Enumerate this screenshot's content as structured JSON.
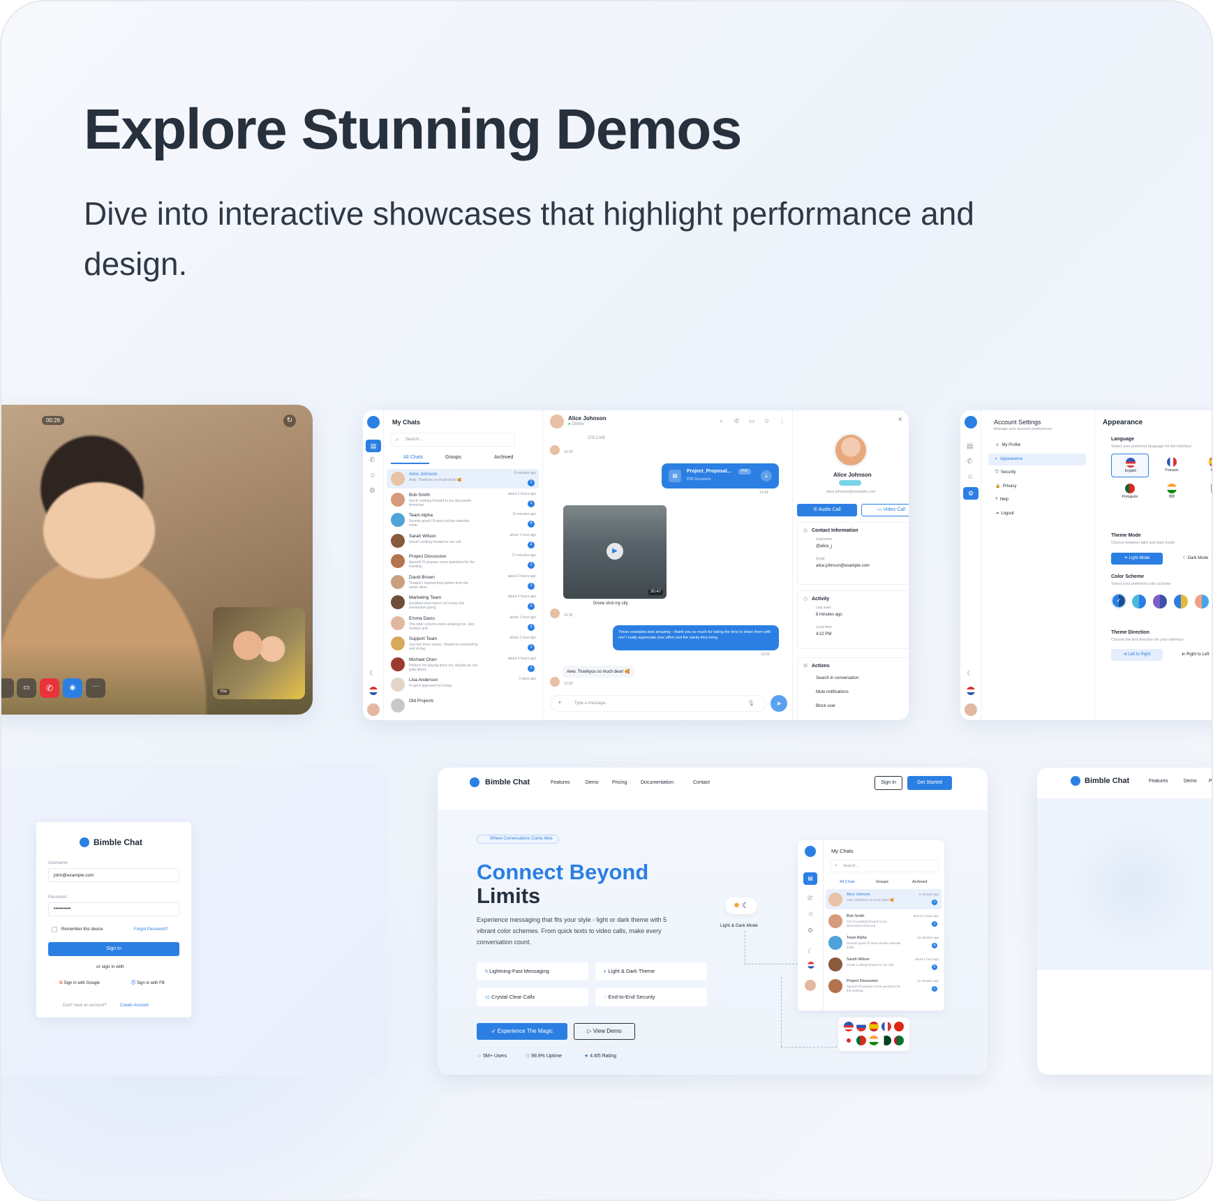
{
  "hero": {
    "title": "Explore Stunning Demos",
    "subtitle": "Dive into interactive showcases that highlight performance and design."
  },
  "video": {
    "timer": "00:26",
    "pip_label": "You"
  },
  "chat": {
    "title": "My Chats",
    "search_placeholder": "Search...",
    "tabs": [
      "All Chats",
      "Groups",
      "Archived"
    ],
    "items": [
      {
        "name": "Alice Johnson",
        "msg": "Aww, Thankyou so much dear! 🥰",
        "time": "8 minutes ago",
        "badge": "1"
      },
      {
        "name": "Bob Smith",
        "msg": "Got it! Looking forward to our discussion tomorrow.",
        "time": "about 2 hours ago",
        "badge": "1"
      },
      {
        "name": "Team Alpha",
        "msg": "Sounds good! I'll send out the calendar invite.",
        "time": "16 minutes ago",
        "badge": "4"
      },
      {
        "name": "Sarah Wilson",
        "msg": "Great! Looking forward to our call.",
        "time": "about 1 hour ago",
        "badge": "2"
      },
      {
        "name": "Project Discussion",
        "msg": "Agreed! I'll prepare some questions for the meeting.",
        "time": "21 minutes ago",
        "badge": "1"
      },
      {
        "name": "David Brown",
        "msg": "Thanks! I learned that pattern from the senior devs.",
        "time": "about 3 hours ago",
        "badge": "1"
      },
      {
        "name": "Marketing Team",
        "msg": "Excellent work team! Let's keep this momentum going.",
        "time": "about 4 hours ago",
        "badge": "1"
      },
      {
        "name": "Emma Davis",
        "msg": "The color scheme looks amazing too. Very modern and",
        "time": "about 1 hour ago",
        "badge": "1"
      },
      {
        "name": "Support Team",
        "msg": "Just two more issues. Should be resolved by end of day.",
        "time": "about 1 hour ago",
        "badge": "1"
      },
      {
        "name": "Michael Chen",
        "msg": "Perfect! I'm staying there too. Maybe we can grab dinner",
        "time": "about 4 hours ago",
        "badge": "1"
      },
      {
        "name": "Lisa Anderson",
        "msg": "I'll get it approved by Friday.",
        "time": "3 days ago",
        "badge": ""
      },
      {
        "name": "Old Projects",
        "msg": "",
        "time": "",
        "badge": ""
      }
    ],
    "conv": {
      "name": "Alice Johnson",
      "status": "Online",
      "file_size": "378.3 KB",
      "t1": "14:29",
      "file_name": "Project_Proposal...",
      "file_badge": "PDF",
      "file_sub": "PDF Document",
      "t2": "14:34",
      "video_len": "30:47",
      "video_caption": "Drone shot my city",
      "t3": "14:36",
      "bubble": "These examples look amazing – thank you so much for taking the time to share them with me! I really appreciate your effort and the clarity they bring.",
      "t4": "15:59",
      "reply": "Aww, Thankyou so much dear! 🥰",
      "t5": "16:00",
      "input_placeholder": "Type a message..."
    },
    "profile": {
      "name": "Alice Johnson",
      "email": "alice.johnson@example.com",
      "audio": "Audio Call",
      "video": "Video Call",
      "contact_title": "Contact Information",
      "username_label": "Username",
      "username": "@alice_j",
      "email_label": "Email",
      "activity_title": "Activity",
      "last_seen_label": "Last seen",
      "last_seen": "8 minutes ago",
      "local_label": "Local time",
      "local": "4:10 PM",
      "actions_title": "Actions",
      "a1": "Search in conversation",
      "a2": "Mute notifications",
      "a3": "Block user"
    }
  },
  "settings": {
    "title": "Account Settings",
    "sub": "Manage your account preferences",
    "menu": [
      "My Profile",
      "Appearance",
      "Security",
      "Privacy",
      "Help",
      "Logout"
    ],
    "appearance": "Appearance",
    "lang_title": "Language",
    "lang_sub": "Select your preferred language for the interface",
    "langs": [
      "English",
      "Français",
      "Esp",
      "Português",
      "हिंदी",
      "A"
    ],
    "theme_title": "Theme Mode",
    "theme_sub": "Choose between light and dark mode",
    "light": "Light Mode",
    "dark": "Dark Mode",
    "color_title": "Color Scheme",
    "color_sub": "Select your preferred color scheme",
    "dir_title": "Theme Direction",
    "dir_sub": "Choose the text direction for your interface",
    "ltr": "Left to Right",
    "rtl": "Right to Left"
  },
  "login": {
    "brand": "Bimble Chat",
    "username_label": "Username",
    "username": "john@example.com",
    "password_label": "Password",
    "password": "••••••••••",
    "remember": "Remember this device",
    "forgot": "Forgot Password?",
    "signin": "Sign In",
    "or": "or sign in with",
    "google": "Sign in with Google",
    "fb": "Sign in with FB",
    "no_account": "Don't have an account?",
    "create": "Create Account"
  },
  "landing": {
    "brand": "Bimble Chat",
    "nav": [
      "Features",
      "Demo",
      "Pricing",
      "Documentation",
      "Contact"
    ],
    "signin": "Sign In",
    "started": "Get Started",
    "tag": "Where Conversations Come Alive",
    "h1a": "Connect Beyond",
    "h1b": "Limits",
    "desc": "Experience messaging that fits your style - light or dark theme with 5 vibrant color schemes. From quick texts to video calls, make every conversation count.",
    "feats": [
      "Lightning-Fast Messaging",
      "Light & Dark Theme",
      "Crystal Clear Calls",
      "End-to-End Security"
    ],
    "cta": "Experience The Magic",
    "demo": "View Demo",
    "stats": [
      "5M+ Users",
      "99.9% Uptime",
      "4.8/5 Rating"
    ],
    "theme_label": "Light & Dark Mode"
  },
  "landing2": {
    "brand": "Bimble Chat",
    "nav": [
      "Features",
      "Demo",
      "P"
    ]
  },
  "colors": {
    "accent": "#2b7fe3",
    "dark_text": "#27303d"
  }
}
